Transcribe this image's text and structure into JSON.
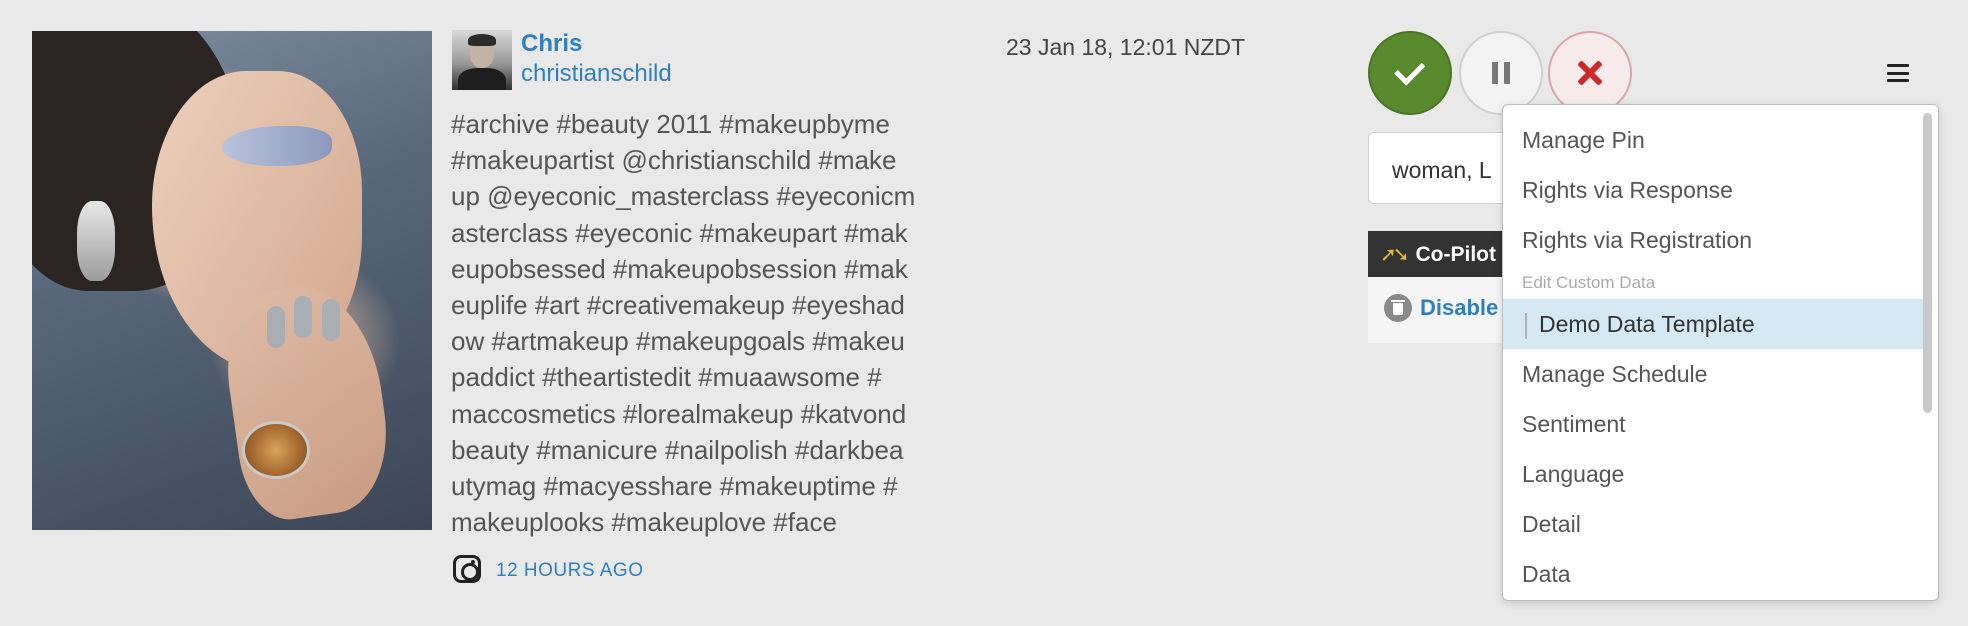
{
  "post": {
    "user_name": "Chris",
    "user_handle": "christianschild",
    "timestamp": "23 Jan 18, 12:01 NZDT",
    "text_lines": [
      "#archive #beauty 2011 #makeupbyme",
      "#makeupartist @christianschild #make",
      "up @eyeconic_masterclass #eyeconicm",
      "asterclass #eyeconic #makeupart #mak",
      "eupobsessed #makeupobsession #mak",
      "euplife #art #creativemakeup #eyeshad",
      "ow #artmakeup #makeupgoals #makeu",
      "paddict #theartistedit #muaawsome #",
      "maccosmetics #lorealmakeup #katvond",
      "beauty #manicure #nailpolish #darkbea",
      "utymag #macyesshare #makeuptime #",
      "makeuplooks #makeuplove #face"
    ],
    "source_icon": "instagram-icon",
    "time_ago": "12 HOURS AGO"
  },
  "actions": {
    "approve_icon": "check-icon",
    "pause_icon": "pause-icon",
    "reject_icon": "x-icon",
    "menu_icon": "hamburger-menu-icon",
    "approve_color": "#5a8a2e",
    "reject_color": "#cc2a2a"
  },
  "side_panel": {
    "tags_value": "woman, L",
    "copilot_label": "Co-Pilot",
    "disable_label": "Disable"
  },
  "dropdown": {
    "items": [
      {
        "label": "Manage Pin"
      },
      {
        "label": "Rights via Response"
      },
      {
        "label": "Rights via Registration"
      }
    ],
    "section_header": "Edit Custom Data",
    "selected_item": "Demo Data Template",
    "items_after": [
      {
        "label": "Manage Schedule"
      },
      {
        "label": "Sentiment"
      },
      {
        "label": "Language"
      },
      {
        "label": "Detail"
      },
      {
        "label": "Data"
      }
    ],
    "selected_bg": "#d4e9f3"
  }
}
